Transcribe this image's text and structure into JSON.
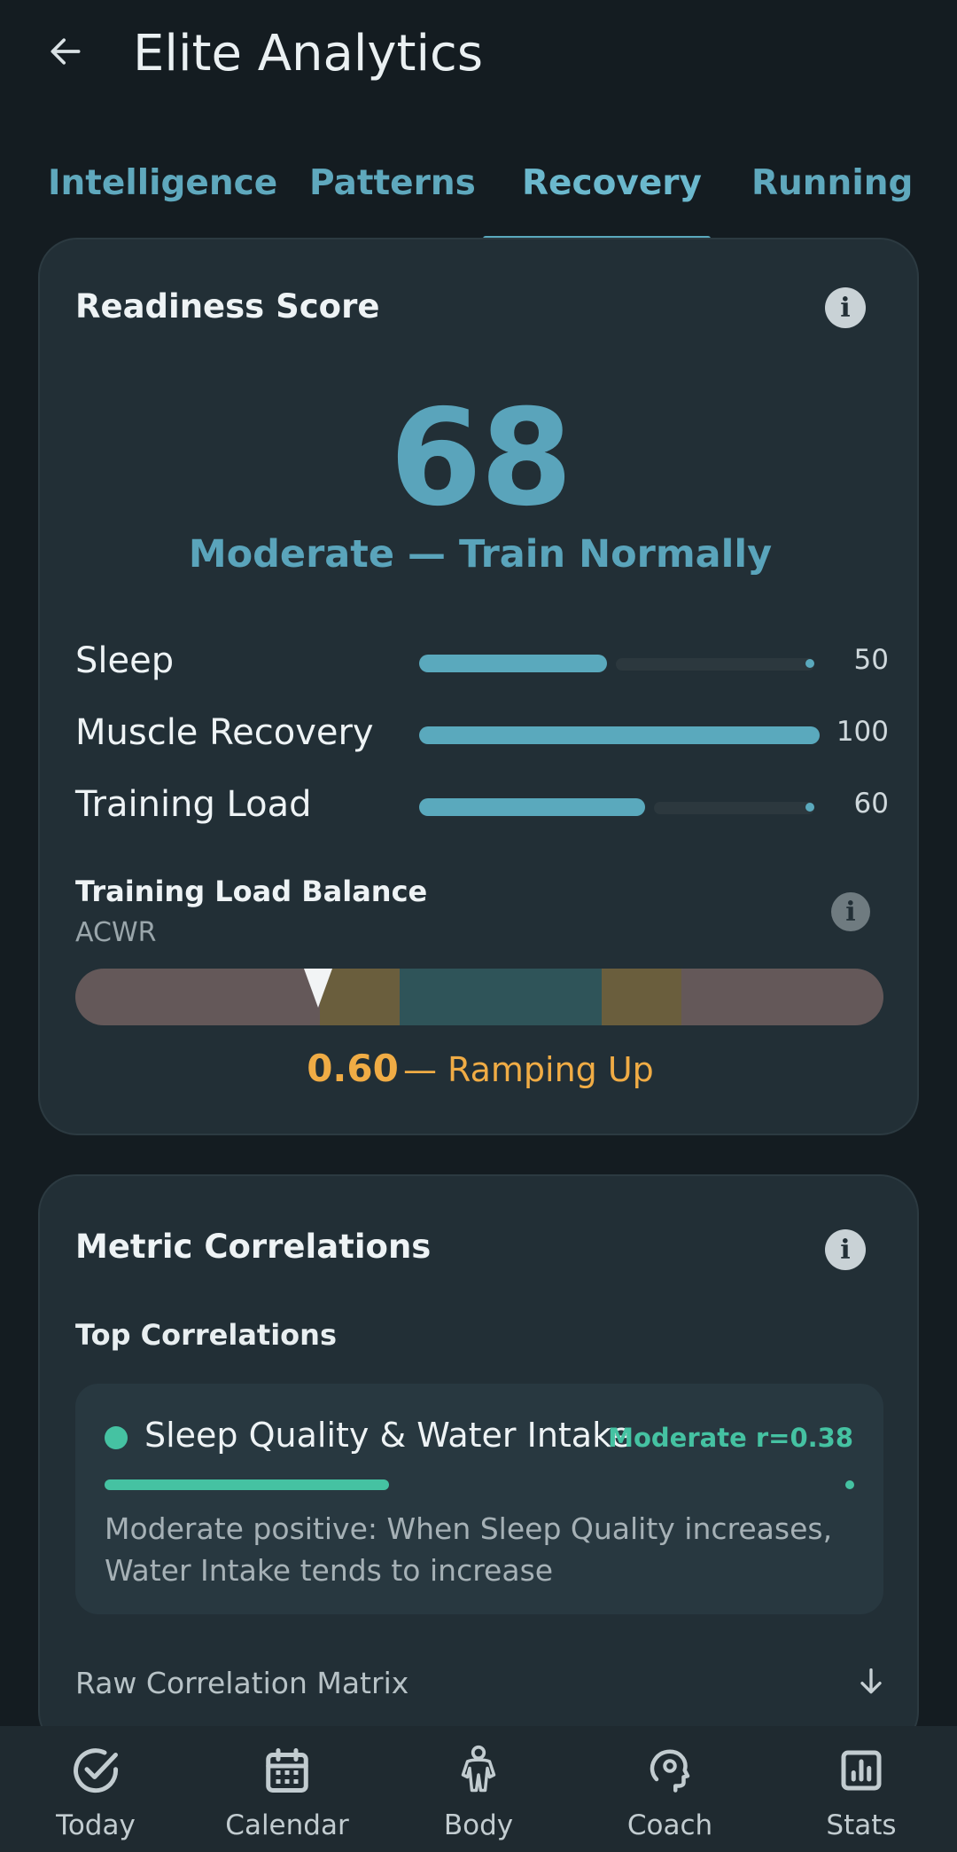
{
  "header": {
    "title": "Elite Analytics"
  },
  "tabs": [
    {
      "label": "Intelligence",
      "active": false
    },
    {
      "label": "Patterns",
      "active": false
    },
    {
      "label": "Recovery",
      "active": true
    },
    {
      "label": "Running",
      "active": false
    }
  ],
  "readiness": {
    "title": "Readiness Score",
    "score": "68",
    "status": "Moderate — Train Normally",
    "metrics": [
      {
        "name": "Sleep",
        "value": "50",
        "fraction": 0.5
      },
      {
        "name": "Muscle Recovery",
        "value": "100",
        "fraction": 1.0
      },
      {
        "name": "Training Load",
        "value": "60",
        "fraction": 0.6
      }
    ]
  },
  "acwr": {
    "title": "Training Load Balance",
    "subtitle": "ACWR",
    "value": "0.60",
    "status": "— Ramping Up",
    "marker_fraction": 0.3,
    "colors": {
      "low": "#645859",
      "caution": "#6a5e3d",
      "optimal": "#2f5459",
      "high": "#645859",
      "value": "#f0ac45"
    }
  },
  "correlations": {
    "title": "Metric Correlations",
    "subheading": "Top Correlations",
    "items": [
      {
        "name": "Sleep Quality & Water Intake",
        "strength": "Moderate r=0.38",
        "r": 0.38,
        "description": "Moderate positive: When Sleep Quality increases, Water Intake tends to increase"
      }
    ],
    "raw_matrix_label": "Raw Correlation Matrix"
  },
  "bottom_nav": [
    {
      "label": "Today",
      "icon": "check-circle-icon"
    },
    {
      "label": "Calendar",
      "icon": "calendar-icon"
    },
    {
      "label": "Body",
      "icon": "body-icon"
    },
    {
      "label": "Coach",
      "icon": "coach-head-icon"
    },
    {
      "label": "Stats",
      "icon": "stats-icon"
    }
  ],
  "colors": {
    "accent": "#5aa9bd",
    "correlation": "#45c2a2",
    "background": "#141c21",
    "card": "#222f36"
  }
}
